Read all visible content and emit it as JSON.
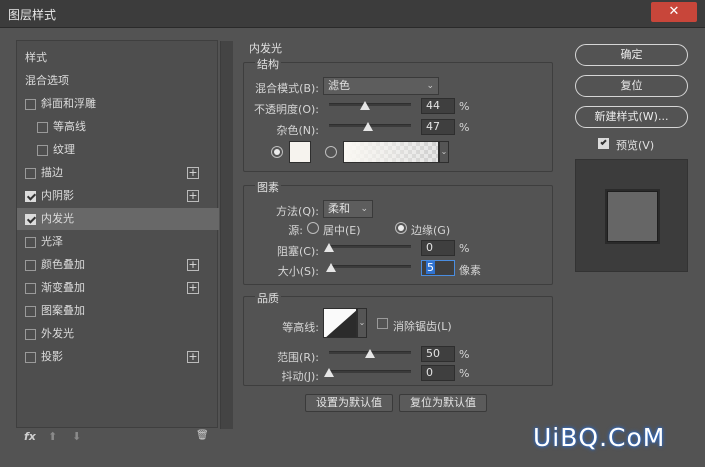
{
  "window": {
    "title": "图层样式",
    "close_glyph": "✕"
  },
  "styles_list": {
    "items": [
      {
        "label": "样式",
        "checkbox": false,
        "checked": false,
        "indent": 0,
        "plus": false,
        "selected": false
      },
      {
        "label": "混合选项",
        "checkbox": false,
        "checked": false,
        "indent": 0,
        "plus": false,
        "selected": false
      },
      {
        "label": "斜面和浮雕",
        "checkbox": true,
        "checked": false,
        "indent": 0,
        "plus": false,
        "selected": false
      },
      {
        "label": "等高线",
        "checkbox": true,
        "checked": false,
        "indent": 1,
        "plus": false,
        "selected": false
      },
      {
        "label": "纹理",
        "checkbox": true,
        "checked": false,
        "indent": 1,
        "plus": false,
        "selected": false
      },
      {
        "label": "描边",
        "checkbox": true,
        "checked": false,
        "indent": 0,
        "plus": true,
        "selected": false
      },
      {
        "label": "内阴影",
        "checkbox": true,
        "checked": true,
        "indent": 0,
        "plus": true,
        "selected": false
      },
      {
        "label": "内发光",
        "checkbox": true,
        "checked": true,
        "indent": 0,
        "plus": false,
        "selected": true
      },
      {
        "label": "光泽",
        "checkbox": true,
        "checked": false,
        "indent": 0,
        "plus": false,
        "selected": false
      },
      {
        "label": "颜色叠加",
        "checkbox": true,
        "checked": false,
        "indent": 0,
        "plus": true,
        "selected": false
      },
      {
        "label": "渐变叠加",
        "checkbox": true,
        "checked": false,
        "indent": 0,
        "plus": true,
        "selected": false
      },
      {
        "label": "图案叠加",
        "checkbox": true,
        "checked": false,
        "indent": 0,
        "plus": false,
        "selected": false
      },
      {
        "label": "外发光",
        "checkbox": true,
        "checked": false,
        "indent": 0,
        "plus": false,
        "selected": false
      },
      {
        "label": "投影",
        "checkbox": true,
        "checked": false,
        "indent": 0,
        "plus": true,
        "selected": false
      }
    ],
    "footer": {
      "fx": "fx",
      "up": "⬆",
      "down": "⬇",
      "trash": "🗑"
    }
  },
  "inner_glow": {
    "title": "内发光",
    "structure": {
      "title": "结构",
      "blend_mode_label": "混合模式(B):",
      "blend_mode_value": "滤色",
      "opacity_label": "不透明度(O):",
      "opacity_value": "44",
      "opacity_pct": 44,
      "noise_label": "杂色(N):",
      "noise_value": "47",
      "noise_pct": 47,
      "percent": "%",
      "color_hex": "#f6f3ee"
    },
    "elements": {
      "title": "图素",
      "technique_label": "方法(Q):",
      "technique_value": "柔和",
      "source_label": "源:",
      "source_center": "居中(E)",
      "source_edge": "边缘(G)",
      "source_selected": "edge",
      "choke_label": "阻塞(C):",
      "choke_value": "0",
      "choke_pct": 0,
      "size_label": "大小(S):",
      "size_value": "5",
      "size_fraction": 0.02,
      "size_unit": "像素",
      "percent": "%"
    },
    "quality": {
      "title": "品质",
      "contour_label": "等高线:",
      "antialias_label": "消除锯齿(L)",
      "antialias_checked": false,
      "range_label": "范围(R):",
      "range_value": "50",
      "range_pct": 50,
      "jitter_label": "抖动(J):",
      "jitter_value": "0",
      "jitter_pct": 0,
      "percent": "%"
    },
    "make_default": "设置为默认值",
    "reset_default": "复位为默认值"
  },
  "actions": {
    "ok": "确定",
    "reset": "复位",
    "new_style": "新建样式(W)...",
    "preview_label": "预览(V)",
    "preview_checked": true
  },
  "watermark": "UiBQ.CoM"
}
